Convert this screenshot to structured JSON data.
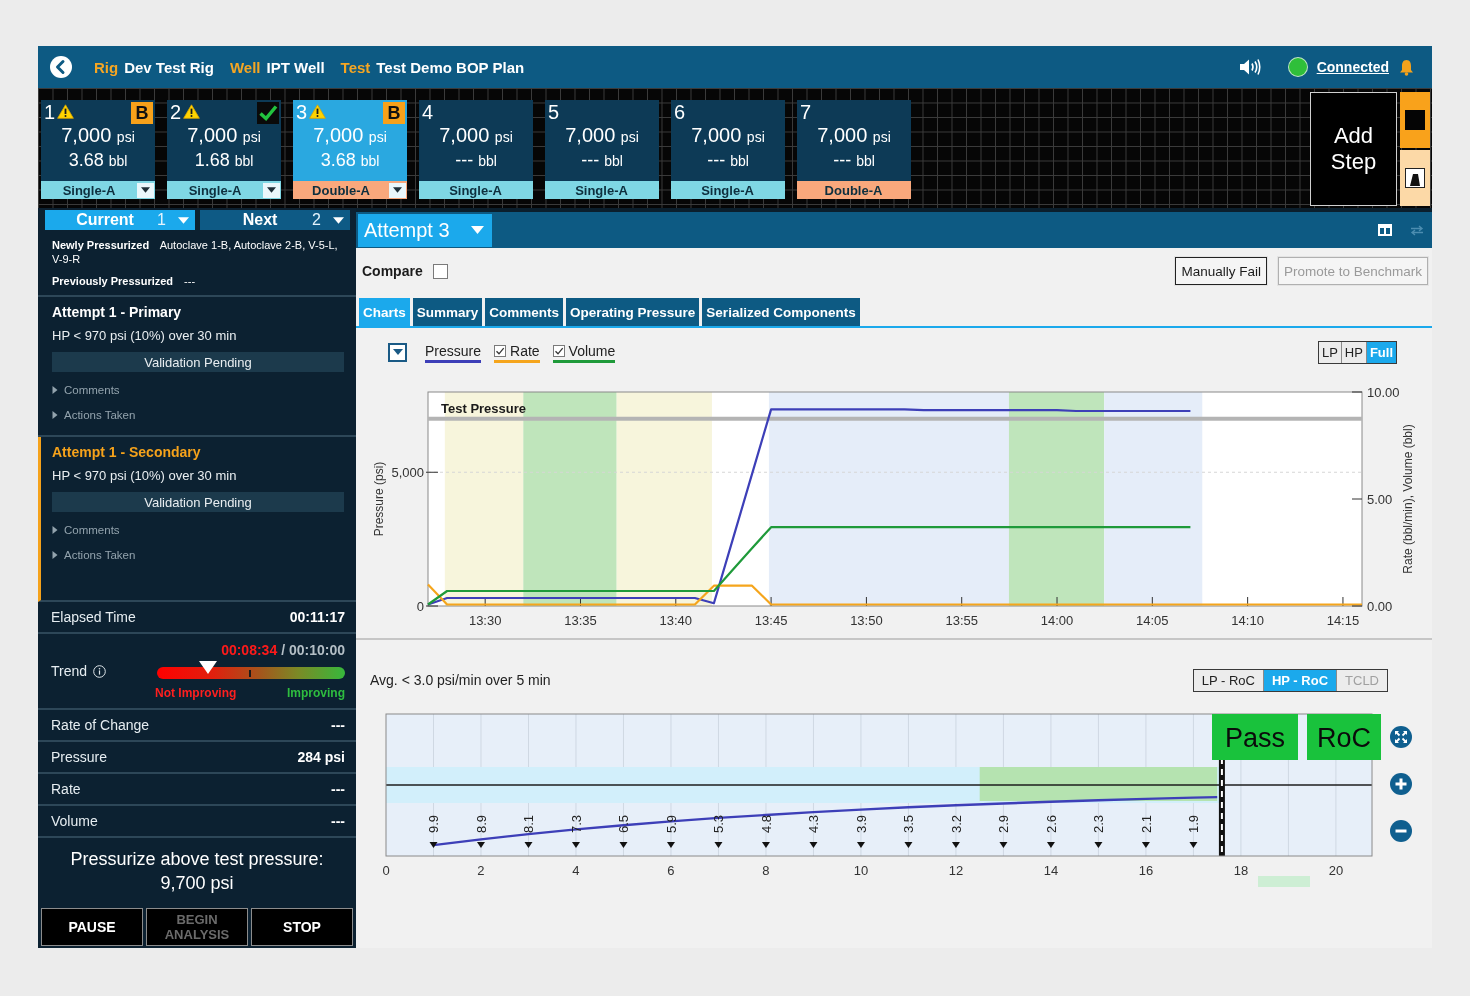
{
  "header": {
    "breadcrumbs": [
      {
        "label": "Rig",
        "value": "Dev Test Rig"
      },
      {
        "label": "Well",
        "value": "IPT Well"
      },
      {
        "label": "Test",
        "value": "Test Demo BOP Plan"
      }
    ],
    "connection": {
      "label": "Connected",
      "connected": true
    }
  },
  "steps": [
    {
      "number": "1",
      "warning": true,
      "flag": {
        "kind": "badge",
        "text": "B"
      },
      "pressure": "7,000",
      "pressure_unit": "psi",
      "volume": "3.68",
      "volume_unit": "bbl",
      "type": "Single-A",
      "color": "#7fd7e4",
      "dropdown": true,
      "selected": false
    },
    {
      "number": "2",
      "warning": true,
      "flag": {
        "kind": "check"
      },
      "pressure": "7,000",
      "pressure_unit": "psi",
      "volume": "1.68",
      "volume_unit": "bbl",
      "type": "Single-A",
      "color": "#7fd7e4",
      "dropdown": true,
      "selected": false
    },
    {
      "number": "3",
      "warning": true,
      "flag": {
        "kind": "badge",
        "text": "B"
      },
      "pressure": "7,000",
      "pressure_unit": "psi",
      "volume": "3.68",
      "volume_unit": "bbl",
      "type": "Double-A",
      "color": "#f9a87c",
      "dropdown": true,
      "selected": true
    },
    {
      "number": "4",
      "warning": false,
      "pressure": "7,000",
      "pressure_unit": "psi",
      "volume": "---",
      "volume_unit": "bbl",
      "type": "Single-A",
      "color": "#7fd7e4",
      "dropdown": false,
      "selected": false
    },
    {
      "number": "5",
      "warning": false,
      "pressure": "7,000",
      "pressure_unit": "psi",
      "volume": "---",
      "volume_unit": "bbl",
      "type": "Single-A",
      "color": "#7fd7e4",
      "dropdown": false,
      "selected": false
    },
    {
      "number": "6",
      "warning": false,
      "pressure": "7,000",
      "pressure_unit": "psi",
      "volume": "---",
      "volume_unit": "bbl",
      "type": "Single-A",
      "color": "#7fd7e4",
      "dropdown": false,
      "selected": false
    },
    {
      "number": "7",
      "warning": false,
      "pressure": "7,000",
      "pressure_unit": "psi",
      "volume": "---",
      "volume_unit": "bbl",
      "type": "Double-A",
      "color": "#f9a87c",
      "dropdown": false,
      "selected": false
    }
  ],
  "add_step": {
    "label": "Add Step"
  },
  "left_panel": {
    "step_selectors": [
      {
        "label": "Current",
        "value": "1",
        "selected": true
      },
      {
        "label": "Next",
        "value": "2",
        "selected": false
      }
    ],
    "pressurization": [
      "**Newly Pressurized** Autoclave 1-B, Autoclave 2-B, V-5-L, V-9-R",
      "**Previously Pressurized** ---"
    ],
    "attempts": [
      {
        "title": "Attempt 1 - Primary",
        "criteria": "HP < 970 psi (10%) over 30 min",
        "status": "Validation Pending",
        "active": false,
        "sections": [
          {
            "label": "Comments",
            "expanded": false
          },
          {
            "label": "Actions Taken",
            "expanded": false
          }
        ]
      },
      {
        "title": "Attempt 1 - Secondary",
        "criteria": "HP < 970 psi (10%) over 30 min",
        "status": "Validation Pending",
        "active": true,
        "sections": [
          {
            "label": "Comments",
            "expanded": false
          },
          {
            "label": "Actions Taken",
            "expanded": false
          }
        ]
      }
    ],
    "elapsed": {
      "label": "Elapsed Time",
      "value": "00:11:17"
    },
    "trend": {
      "label": "Trend",
      "time_elapsed": "00:08:34",
      "time_limit": "/ 00:10:00",
      "level": 0.27,
      "low_label": "Not Improving",
      "high_label": "Improving"
    },
    "readings": [
      {
        "label": "Rate of Change",
        "value": "---"
      },
      {
        "label": "Pressure",
        "value": "284 psi"
      },
      {
        "label": "Rate",
        "value": "---"
      },
      {
        "label": "Volume",
        "value": "---"
      }
    ],
    "instruction": "Pressurize above test pressure: 9,700 psi",
    "actions": [
      {
        "label": "PAUSE",
        "disabled": false
      },
      {
        "label": "BEGIN ANALYSIS",
        "disabled": true
      },
      {
        "label": "STOP",
        "disabled": false
      }
    ]
  },
  "main": {
    "attempt_selector": {
      "label": "Attempt 3"
    },
    "compare": {
      "label": "Compare",
      "checked": false
    },
    "buttons": [
      {
        "label": "Manually Fail",
        "disabled": false
      },
      {
        "label": "Promote to Benchmark",
        "disabled": true
      }
    ],
    "tabs": [
      {
        "label": "Charts",
        "selected": true
      },
      {
        "label": "Summary",
        "selected": false
      },
      {
        "label": "Comments",
        "selected": false
      },
      {
        "label": "Operating Pressure",
        "selected": false
      },
      {
        "label": "Serialized Components",
        "selected": false
      }
    ],
    "chart_panel": {
      "legend": [
        {
          "kind": "plain"
        },
        {
          "kind": "checkbox",
          "checked": true
        },
        {
          "kind": "checkbox",
          "checked": true
        }
      ],
      "range_toggle": [
        {
          "label": "LP",
          "selected": false
        },
        {
          "label": "HP",
          "selected": false
        },
        {
          "label": "Full",
          "selected": true
        }
      ],
      "chart_data": {
        "type": "line",
        "grid": true,
        "ylabel": "Pressure (psi)",
        "y2label": "Rate (bbl/min), Volume (bbl)",
        "categories": [
          null,
          null,
          null,
          "13:30",
          null,
          null,
          null,
          null,
          "13:35",
          null,
          null,
          null,
          null,
          "13:40",
          null,
          null,
          null,
          null,
          "13:45",
          null,
          null,
          null,
          null,
          "13:50",
          null,
          null,
          null,
          null,
          "13:55",
          null,
          null,
          null,
          null,
          "14:00",
          null,
          null,
          null,
          null,
          "14:05",
          null,
          null,
          null,
          null,
          "14:10",
          null,
          null,
          null,
          null,
          "14:15",
          null
        ],
        "series": [
          {
            "name": "Pressure",
            "color": "#3d3fb8",
            "values": [
              0,
              300,
              300,
              300,
              300,
              300,
              300,
              300,
              300,
              300,
              300,
              300,
              300,
              300,
              300,
              100,
              2520,
              4930,
              7350,
              7350,
              7350,
              7350,
              7350,
              7350,
              7350,
              7350,
              7320,
              7320,
              7320,
              7320,
              7320,
              7320,
              7320,
              7320,
              7290,
              7290,
              7290,
              7290,
              7290,
              7290,
              7290,
              null,
              null,
              null,
              null,
              null,
              null,
              null,
              null,
              null
            ]
          },
          {
            "name": "Rate",
            "color": "#f5a51c",
            "axis": "y2",
            "values": [
              1,
              0,
              0,
              0,
              0,
              0,
              0,
              0,
              0,
              0,
              0,
              0,
              0,
              0,
              0,
              0.95,
              0.95,
              0.95,
              0,
              0,
              0,
              0,
              0,
              0,
              0,
              0,
              0,
              0,
              0,
              0,
              0,
              0,
              0,
              0,
              0,
              0,
              0,
              0,
              0,
              0,
              0,
              0,
              0,
              0,
              0,
              0,
              0,
              0,
              0,
              0
            ]
          },
          {
            "name": "Volume",
            "color": "#1f9a3a",
            "axis": "y2",
            "values": [
              0,
              0.7,
              0.7,
              0.7,
              0.7,
              0.7,
              0.7,
              0.7,
              0.7,
              0.7,
              0.7,
              0.7,
              0.7,
              0.7,
              0.7,
              0.7,
              1.7,
              2.7,
              3.68,
              3.68,
              3.68,
              3.68,
              3.68,
              3.68,
              3.68,
              3.68,
              3.68,
              3.68,
              3.68,
              3.68,
              3.68,
              3.68,
              3.68,
              3.68,
              3.68,
              3.68,
              3.68,
              3.68,
              3.68,
              3.68,
              3.68,
              null,
              null,
              null,
              null,
              null,
              null,
              null,
              null,
              null
            ]
          }
        ],
        "ylim": [
          0,
          8000
        ],
        "y2lim": [
          0,
          10
        ],
        "yticks": [
          {
            "value": 0,
            "label": "0"
          },
          {
            "value": 5000,
            "label": "5,000"
          }
        ],
        "y2ticks": [
          {
            "value": 0,
            "label": "0.00"
          },
          {
            "value": 5,
            "label": "5.00"
          },
          {
            "value": 10,
            "label": "10.00"
          }
        ],
        "ref_lines": [
          {
            "axis": "y",
            "value": 7000,
            "label": "Test Pressure"
          }
        ]
      }
    },
    "roc_panel": {
      "criteria": "Avg. < 3.0 psi/min over 5 min",
      "toggle": [
        {
          "label": "LP - RoC",
          "selected": false,
          "disabled": false
        },
        {
          "label": "HP - RoC",
          "selected": true,
          "disabled": false
        },
        {
          "label": "TCLD",
          "selected": false,
          "disabled": true
        }
      ],
      "badges": [
        "Pass",
        "RoC"
      ],
      "minute_labels": [
        "9.9",
        "8.9",
        "8.1",
        "7.3",
        "6.5",
        "5.9",
        "5.3",
        "4.8",
        "4.3",
        "3.9",
        "3.5",
        "3.2",
        "2.9",
        "2.6",
        "2.3",
        "2.1",
        "1.9"
      ],
      "axis_labels": [
        "0",
        "2",
        "4",
        "6",
        "8",
        "10",
        "12",
        "14",
        "16",
        "18",
        "20"
      ]
    }
  }
}
